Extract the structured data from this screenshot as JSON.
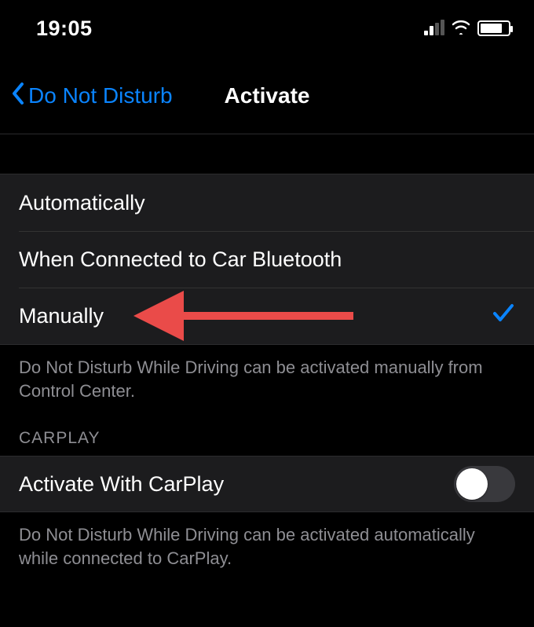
{
  "status": {
    "time": "19:05"
  },
  "nav": {
    "back_label": "Do Not Disturb",
    "title": "Activate"
  },
  "activation": {
    "options": [
      {
        "label": "Automatically",
        "selected": false
      },
      {
        "label": "When Connected to Car Bluetooth",
        "selected": false
      },
      {
        "label": "Manually",
        "selected": true
      }
    ],
    "footer": "Do Not Disturb While Driving can be activated manually from Control Center."
  },
  "carplay": {
    "section_header": "CARPLAY",
    "toggle_label": "Activate With CarPlay",
    "toggle_on": false,
    "footer": "Do Not Disturb While Driving can be activated automatically while connected to CarPlay."
  },
  "annotation": {
    "arrow_color": "#ea4b49"
  }
}
